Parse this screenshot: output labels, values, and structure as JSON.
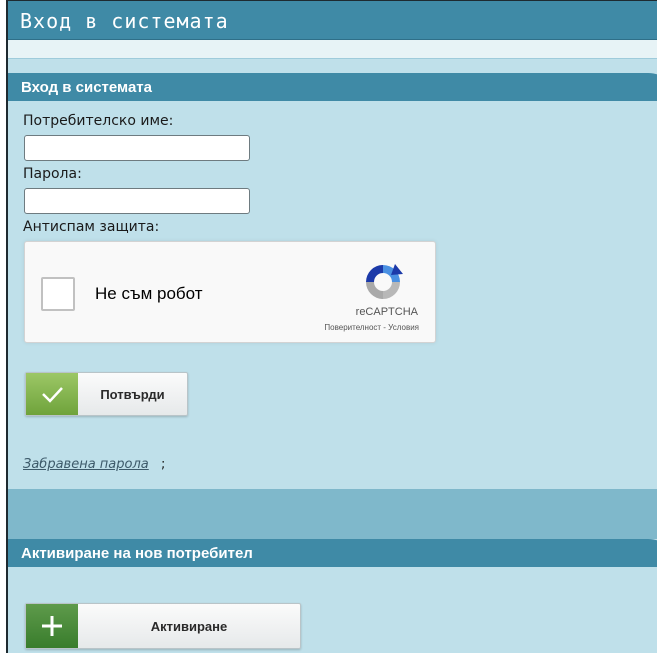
{
  "window": {
    "title": "Вход в системата"
  },
  "login": {
    "header": "Вход в системата",
    "username_label": "Потребителско име:",
    "username_value": "",
    "password_label": "Парола:",
    "password_value": "",
    "antispam_label": "Антиспам защита:",
    "recaptcha": {
      "checkbox_label": "Не съм робот",
      "brand": "reCAPTCHA",
      "legal": "Поверителност - Условия"
    },
    "submit_label": "Потвърди",
    "forgot_link": "Забравена парола",
    "forgot_suffix": ";"
  },
  "activation": {
    "header": "Активиране на нов потребител",
    "button_label": "Активиране"
  },
  "icons": {
    "submit": "check-icon",
    "activate": "plus-icon",
    "recaptcha": "recaptcha-logo-icon"
  },
  "colors": {
    "header_bg": "#3f8aa6",
    "panel_bg": "#bfe0ea",
    "submit_icon_bg": "#86b852",
    "activate_icon_bg": "#4a8c3b"
  }
}
